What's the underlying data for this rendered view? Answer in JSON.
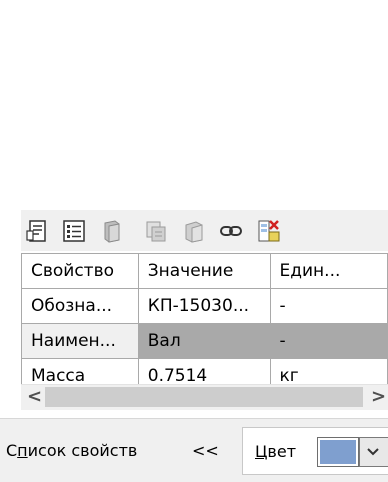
{
  "toolbar": {
    "icons": [
      "properties-icon",
      "list-icon",
      "book-icon",
      "database-icon",
      "book-add-icon",
      "link-icon",
      "delete-table-icon"
    ]
  },
  "table": {
    "rows": [
      [
        "Свойство",
        "Значение",
        "Един..."
      ],
      [
        "Обозна...",
        "КП-15030...",
        "-"
      ],
      [
        "Наимен...",
        "Вал",
        "-"
      ],
      [
        "Масса",
        "0.7514",
        "кг"
      ]
    ]
  },
  "scroll": {
    "left_arrow": "<",
    "right_arrow": ">"
  },
  "bottom": {
    "properties_list_prefix": "С",
    "properties_list_underlined": "п",
    "properties_list_rest": "исок свойств",
    "collapse": "<<",
    "color_underlined": "Ц",
    "color_rest": "вет",
    "color_value": "#7f9fcf"
  }
}
